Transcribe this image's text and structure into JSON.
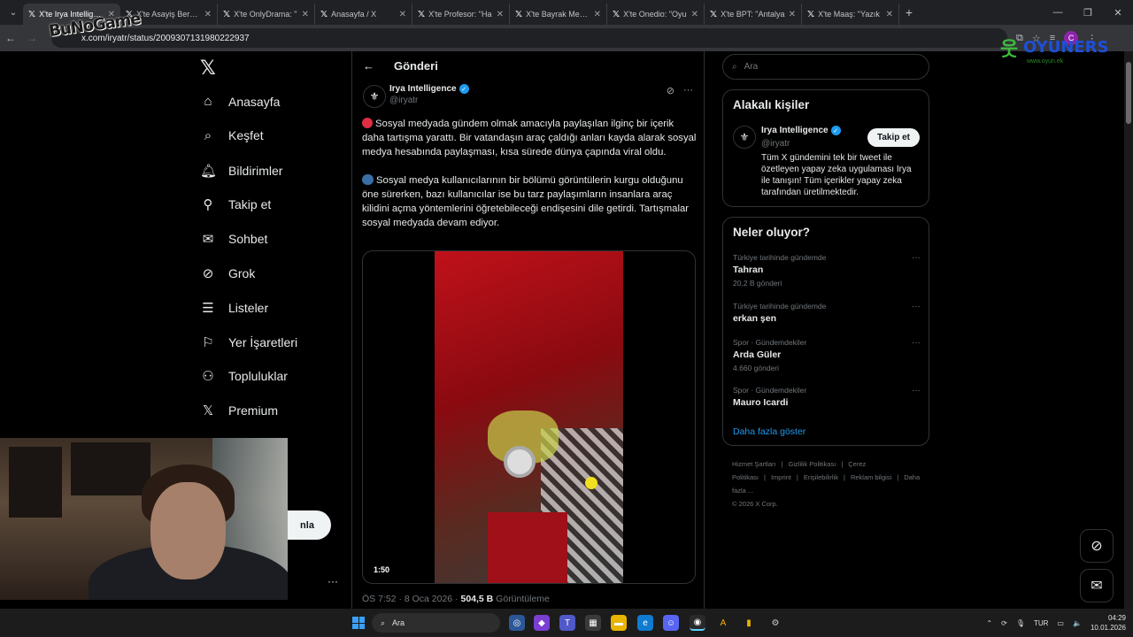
{
  "browser": {
    "tabs": [
      {
        "label": "X'te Irya Intelligence",
        "active": true
      },
      {
        "label": "X'te Asayiş Berkemal"
      },
      {
        "label": "X'te OnlyDrama: \""
      },
      {
        "label": "Anasayfa / X"
      },
      {
        "label": "X'te Profesor: \"Ha"
      },
      {
        "label": "X'te Bayrak Medya"
      },
      {
        "label": "X'te Onedio: \"Oyu"
      },
      {
        "label": "X'te BPT: \"Antalya"
      },
      {
        "label": "X'te Maaş: \"Yazık"
      }
    ],
    "url": "x.com/iryatr/status/2009307131980222937",
    "profile_initial": "C"
  },
  "nav": {
    "items": [
      {
        "label": "Anasayfa",
        "icon": "home-icon"
      },
      {
        "label": "Keşfet",
        "icon": "search-icon"
      },
      {
        "label": "Bildirimler",
        "icon": "bell-icon"
      },
      {
        "label": "Takip et",
        "icon": "add-user-icon"
      },
      {
        "label": "Sohbet",
        "icon": "mail-icon"
      },
      {
        "label": "Grok",
        "icon": "grok-icon"
      },
      {
        "label": "Listeler",
        "icon": "list-icon"
      },
      {
        "label": "Yer İşaretleri",
        "icon": "bookmark-icon"
      },
      {
        "label": "Topluluklar",
        "icon": "communities-icon"
      },
      {
        "label": "Premium",
        "icon": "x-logo-icon"
      }
    ],
    "post_button": "nla"
  },
  "post": {
    "header_title": "Gönderi",
    "author_name": "Irya Intelligence",
    "author_handle": "@iryatr",
    "paragraph1": "Sosyal medyada gündem olmak amacıyla paylaşılan ilginç bir içerik daha tartışma yarattı. Bir vatandaşın araç çaldığı anları kayda alarak sosyal medya hesabında paylaşması, kısa sürede dünya çapında viral oldu.",
    "paragraph2": "Sosyal medya kullanıcılarının bir bölümü görüntülerin kurgu olduğunu öne sürerken, bazı kullanıcılar ise bu tarz paylaşımların insanlara araç kilidini açma yöntemlerini öğretebileceği endişesini dile getirdi. Tartışmalar sosyal medyada devam ediyor.",
    "video_duration": "1:50",
    "time": "ÖS 7:52 · 8 Oca 2026 · ",
    "views": "504,5 B",
    "views_label": " Görüntüleme"
  },
  "sidebar": {
    "search_placeholder": "Ara",
    "related_title": "Alakalı kişiler",
    "related": {
      "name": "Irya Intelligence",
      "handle": "@iryatr",
      "follow_label": "Takip et",
      "bio": "Tüm X gündemini tek bir tweet ile özetleyen yapay zeka uygulaması Irya ile tanışın! Tüm içerikler yapay zeka tarafından üretilmektedir."
    },
    "trends_title": "Neler oluyor?",
    "trends": [
      {
        "context": "Türkiye tarihinde gündemde",
        "title": "Tahran",
        "count": "20,2 B gönderi"
      },
      {
        "context": "Türkiye tarihinde gündemde",
        "title": "erkan şen",
        "count": ""
      },
      {
        "context": "Spor · Gündemdekiler",
        "title": "Arda Güler",
        "count": "4.660 gönderi"
      },
      {
        "context": "Spor · Gündemdekiler",
        "title": "Mauro Icardi",
        "count": ""
      }
    ],
    "show_more": "Daha fazla göster",
    "footer_links": [
      "Hizmet Şartları",
      "|",
      "Gizlilik Politikası",
      "|",
      "Çerez Politikası",
      "|",
      "Imprint",
      "|",
      "Erişilebilirlik",
      "|",
      "Reklam bilgisi",
      "|",
      "Daha fazla ..."
    ],
    "copyright": "© 2026 X Corp."
  },
  "watermarks": {
    "left": "BuNoGame",
    "right": "OYUNERS",
    "right_sub": "www.oyun.ek"
  },
  "taskbar": {
    "search_placeholder": "Ara",
    "language": "TUR",
    "time": "04:29",
    "date": "10.01.2026"
  }
}
